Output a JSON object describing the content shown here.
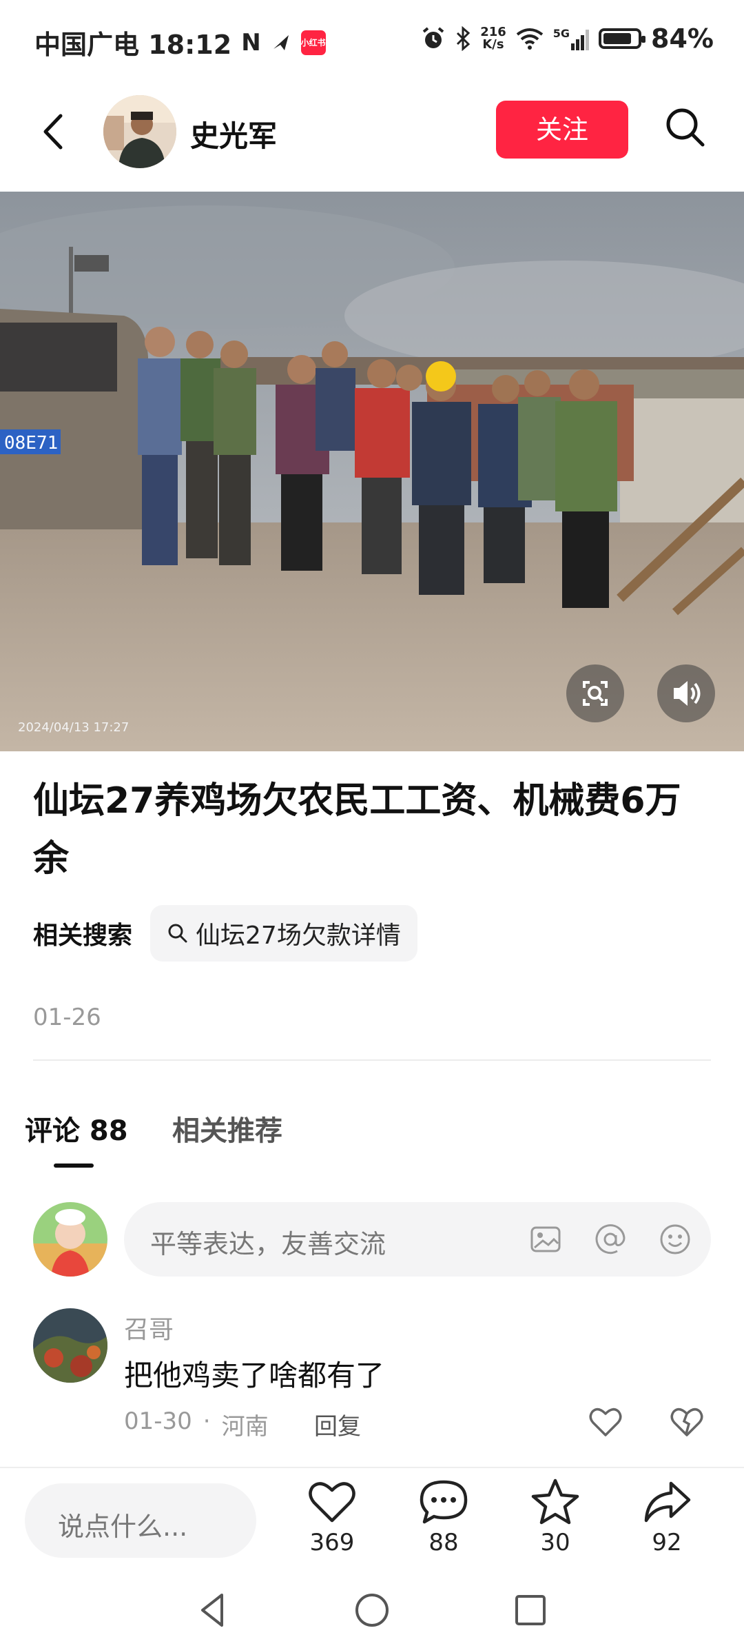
{
  "status_bar": {
    "carrier_time": "中国广电 18:12",
    "nfc_symbol": "N",
    "app_badge": "小红书",
    "net_speed_value": "216",
    "net_speed_unit": "K/s",
    "network": "5G",
    "battery": "84%",
    "battery_level": 0.84
  },
  "header": {
    "author_name": "史光军",
    "follow_label": "关注"
  },
  "video": {
    "timestamp": "2024/04/13 17:27",
    "plate": "08E71"
  },
  "post": {
    "title": "仙坛27养鸡场欠农民工工资、机械费6万余",
    "related_label": "相关搜索",
    "related_query": "仙坛27场欠款详情",
    "date": "01-26"
  },
  "tabs": [
    {
      "label": "评论 88"
    },
    {
      "label": "相关推荐"
    }
  ],
  "comment_input": {
    "placeholder": "平等表达，友善交流"
  },
  "comments": [
    {
      "user": "召哥",
      "text": "把他鸡卖了啥都有了",
      "date": "01-30",
      "location": "河南",
      "reply_label": "回复"
    }
  ],
  "bottom_bar": {
    "say_placeholder": "说点什么...",
    "likes": "369",
    "comments": "88",
    "favorites": "30",
    "shares": "92"
  },
  "icons": {
    "back": "back-arrow-icon",
    "search": "search-icon",
    "screenshot_scan": "scan-icon",
    "volume": "volume-icon",
    "image": "image-icon",
    "mention": "at-icon",
    "emoji": "emoji-icon",
    "like": "heart-icon",
    "dislike": "broken-heart-icon",
    "comment": "comment-bubble-icon",
    "favorite": "star-icon",
    "share": "share-arrow-icon"
  },
  "colors": {
    "accent": "#ff2442",
    "text_primary": "#111111",
    "text_secondary": "#999999",
    "chip_bg": "#f4f4f5"
  }
}
